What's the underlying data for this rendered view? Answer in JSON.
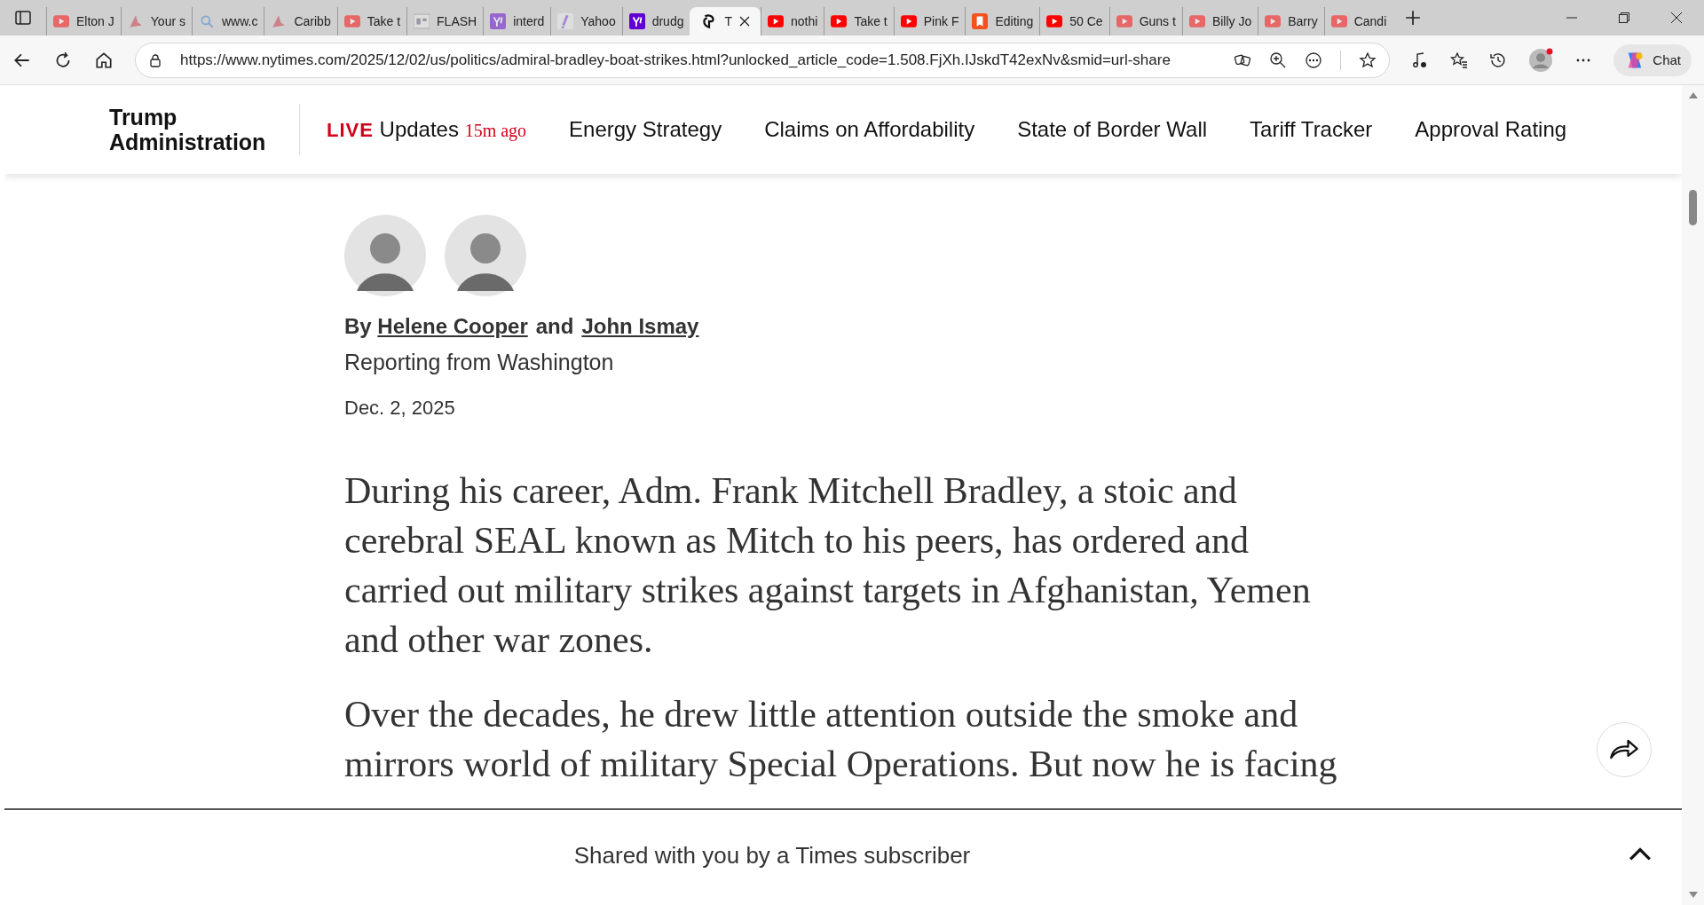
{
  "tabs": [
    {
      "label": "Elton J",
      "kind": "video",
      "faded": true,
      "selected": false
    },
    {
      "label": "Your s",
      "kind": "plane",
      "faded": true,
      "selected": false
    },
    {
      "label": "www.c",
      "kind": "search",
      "faded": true,
      "selected": false
    },
    {
      "label": "Caribb",
      "kind": "plane",
      "faded": true,
      "selected": false
    },
    {
      "label": "Take t",
      "kind": "video",
      "faded": true,
      "selected": false
    },
    {
      "label": "FLASH",
      "kind": "gp",
      "faded": true,
      "selected": false
    },
    {
      "label": "interd",
      "kind": "yahoo",
      "faded": true,
      "selected": false
    },
    {
      "label": "Yahoo",
      "kind": "slash",
      "faded": true,
      "selected": false
    },
    {
      "label": "drudg",
      "kind": "yahoo",
      "faded": false,
      "selected": false
    },
    {
      "label": "T",
      "kind": "nyt",
      "faded": false,
      "selected": true
    },
    {
      "label": "nothi",
      "kind": "video",
      "faded": false,
      "selected": false
    },
    {
      "label": "Take t",
      "kind": "video",
      "faded": false,
      "selected": false
    },
    {
      "label": "Pink F",
      "kind": "video",
      "faded": false,
      "selected": false
    },
    {
      "label": "Editing",
      "kind": "bookmark",
      "faded": false,
      "selected": false
    },
    {
      "label": "50 Ce",
      "kind": "video",
      "faded": false,
      "selected": false
    },
    {
      "label": "Guns t",
      "kind": "video",
      "faded": true,
      "selected": false
    },
    {
      "label": "Billy Jo",
      "kind": "video",
      "faded": true,
      "selected": false
    },
    {
      "label": "Barry",
      "kind": "video",
      "faded": true,
      "selected": false
    },
    {
      "label": "Candi",
      "kind": "video",
      "faded": true,
      "selected": false
    }
  ],
  "address_bar": {
    "url": "https://www.nytimes.com/2025/12/02/us/politics/admiral-bradley-boat-strikes.html?unlocked_article_code=1.508.FjXh.IJskdT42exNv&smid=url-share"
  },
  "toolbar": {
    "chat_label": "Chat"
  },
  "section_nav": {
    "title": "Trump Administration",
    "live": {
      "badge": "LIVE",
      "label": "Updates",
      "time": "15m ago"
    },
    "items": [
      "Energy Strategy",
      "Claims on Affordability",
      "State of Border Wall",
      "Tariff Tracker",
      "Approval Rating"
    ]
  },
  "article": {
    "byline": {
      "prefix": "By",
      "authors": [
        "Helene Cooper",
        "John Ismay"
      ],
      "joiner": "and"
    },
    "dateline": "Reporting from Washington",
    "date": "Dec. 2, 2025",
    "paragraphs": [
      "During his career, Adm. Frank Mitchell Bradley, a stoic and cerebral SEAL known as Mitch to his peers, has ordered and carried out military strikes against targets in Afghanistan, Yemen and other war zones.",
      "Over the decades, he drew little attention outside the smoke and mirrors world of military Special Operations. But now he is facing"
    ]
  },
  "share_bar": {
    "text": "Shared with you by a Times subscriber"
  }
}
